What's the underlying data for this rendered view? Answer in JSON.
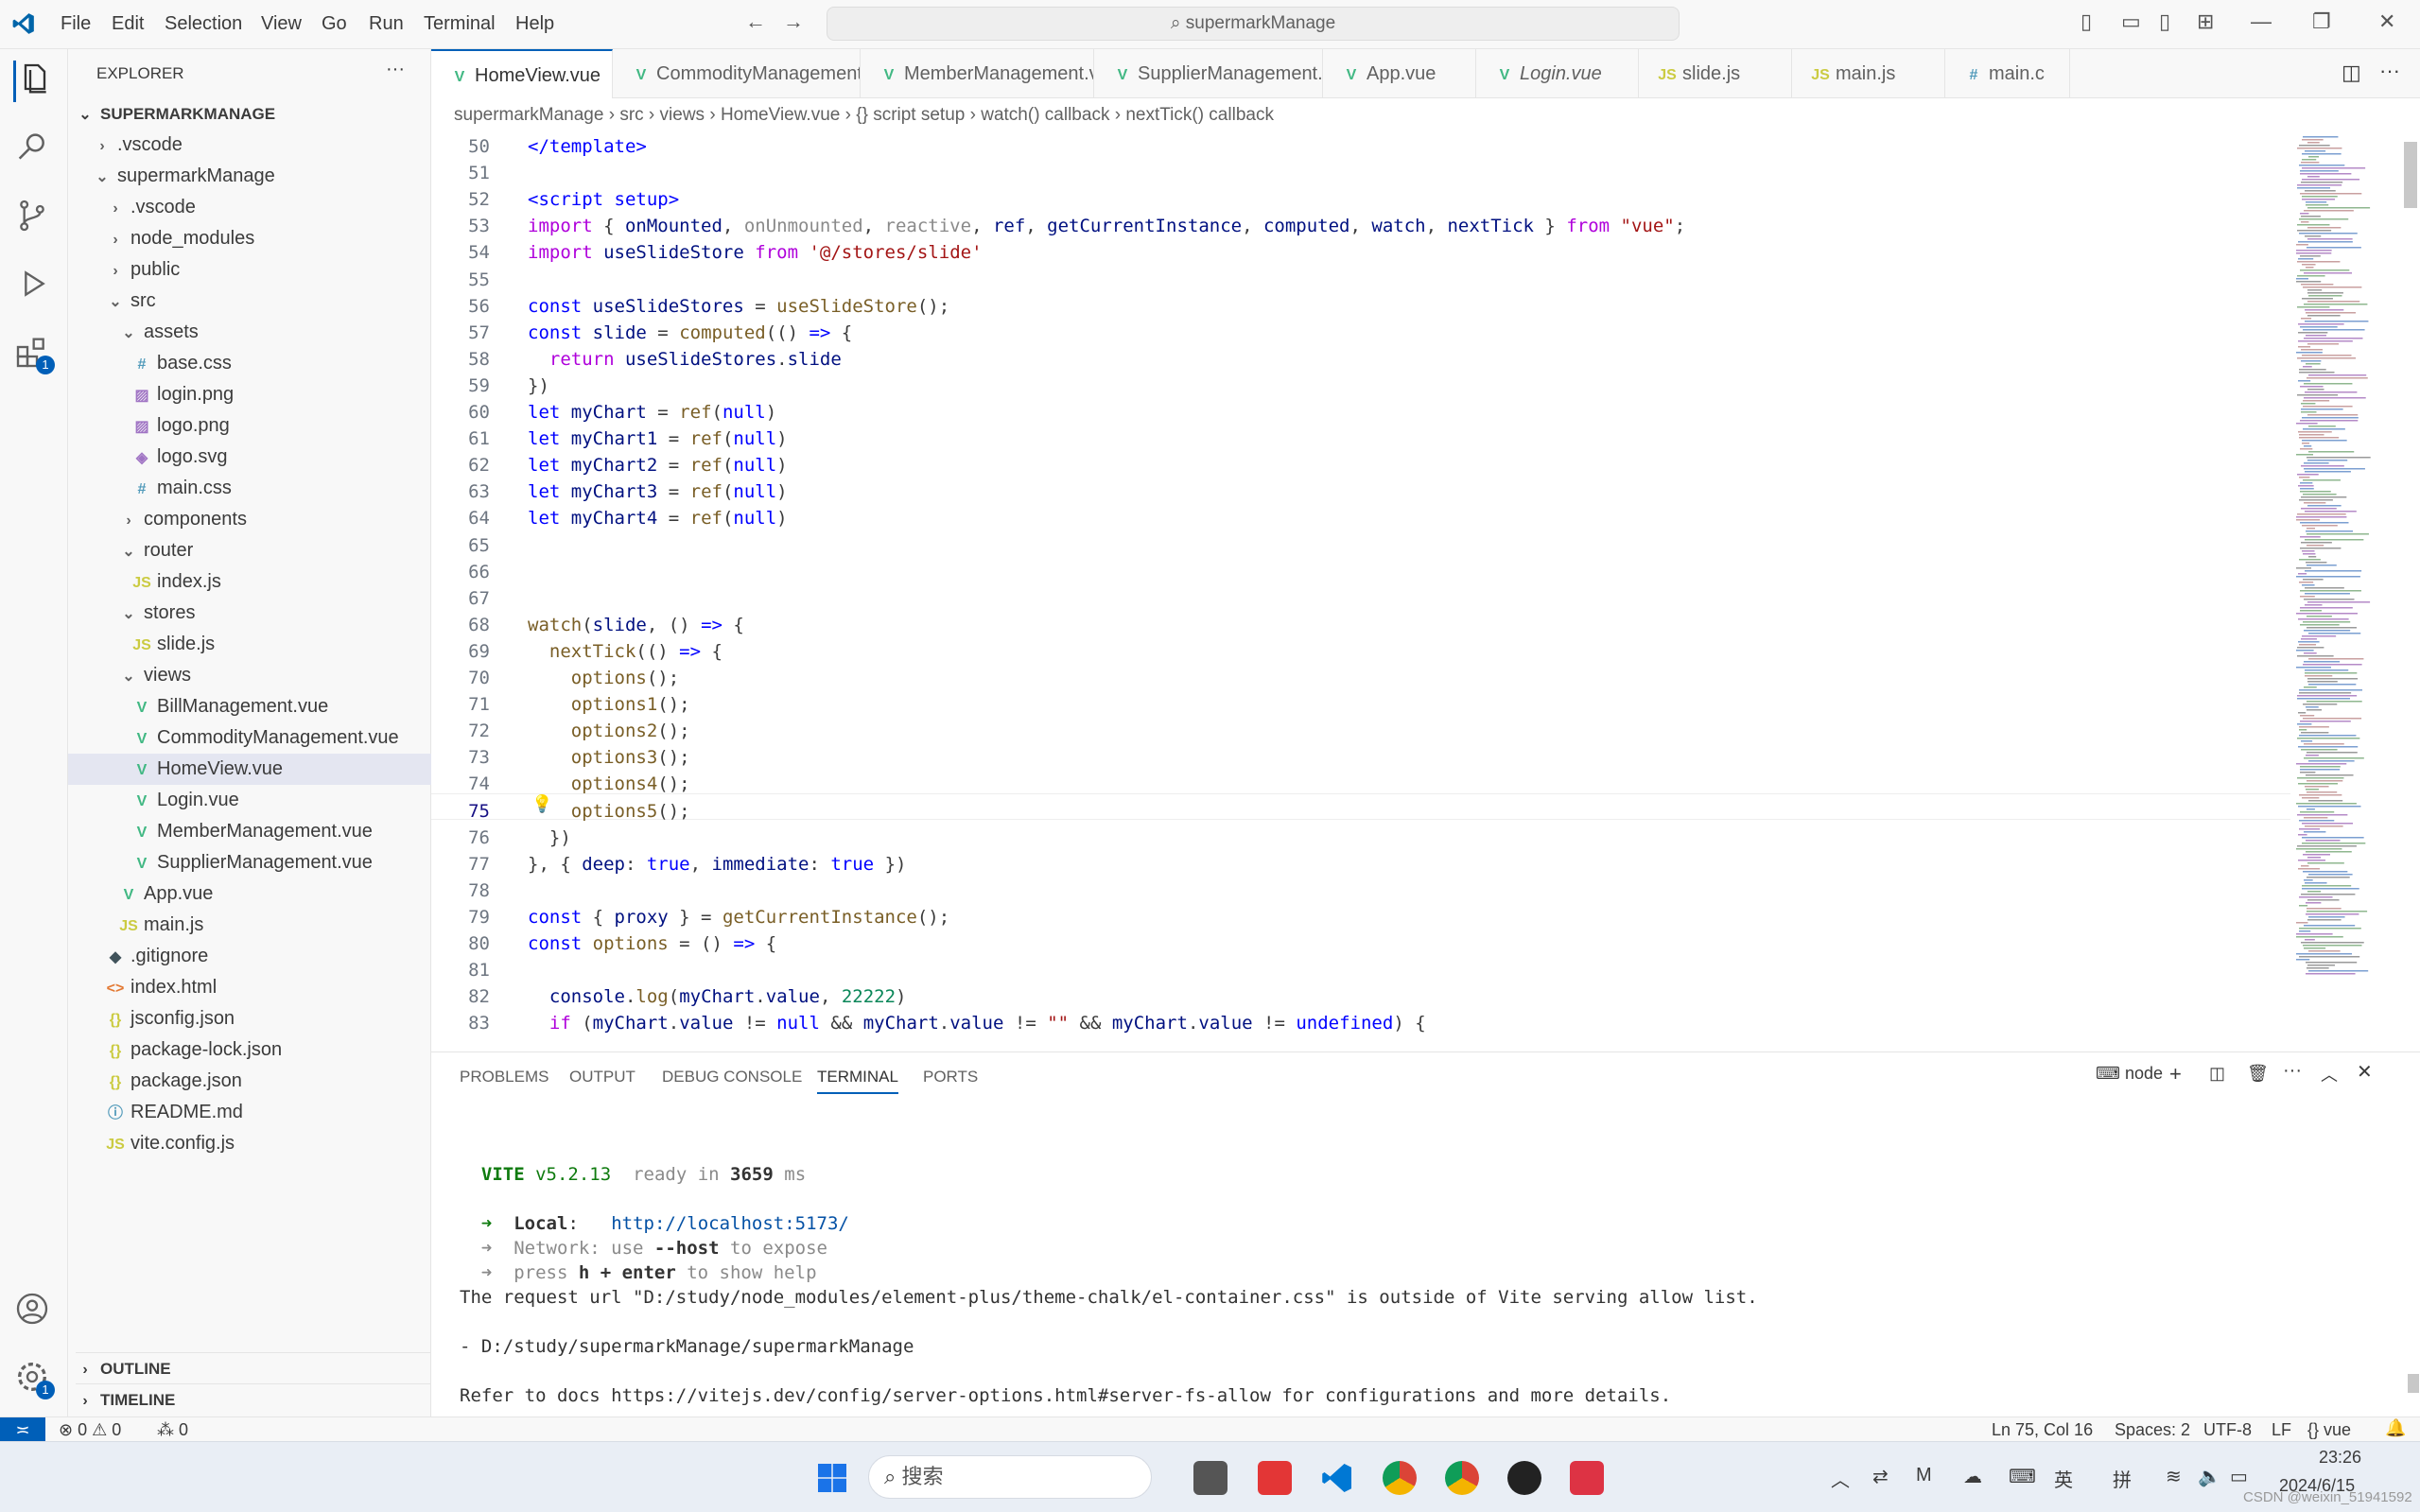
{
  "titlebar": {
    "menus": [
      "File",
      "Edit",
      "Selection",
      "View",
      "Go",
      "Run",
      "Terminal",
      "Help"
    ],
    "search": "supermarkManage"
  },
  "sidebar": {
    "title": "EXPLORER",
    "root": "SUPERMARKMANAGE",
    "items": [
      {
        "label": ".vscode",
        "icon": "chevron-right",
        "depth": 0
      },
      {
        "label": "supermarkManage",
        "icon": "chevron-down",
        "depth": 0
      },
      {
        "label": ".vscode",
        "icon": "chevron-right",
        "depth": 1
      },
      {
        "label": "node_modules",
        "icon": "chevron-right",
        "depth": 1
      },
      {
        "label": "public",
        "icon": "chevron-right",
        "depth": 1
      },
      {
        "label": "src",
        "icon": "chevron-down",
        "depth": 1
      },
      {
        "label": "assets",
        "icon": "chevron-down",
        "depth": 2
      },
      {
        "label": "base.css",
        "icon": "css",
        "depth": 3
      },
      {
        "label": "login.png",
        "icon": "image",
        "depth": 3
      },
      {
        "label": "logo.png",
        "icon": "image",
        "depth": 3
      },
      {
        "label": "logo.svg",
        "icon": "svg",
        "depth": 3
      },
      {
        "label": "main.css",
        "icon": "css",
        "depth": 3
      },
      {
        "label": "components",
        "icon": "chevron-right",
        "depth": 2
      },
      {
        "label": "router",
        "icon": "chevron-down",
        "depth": 2
      },
      {
        "label": "index.js",
        "icon": "js",
        "depth": 3
      },
      {
        "label": "stores",
        "icon": "chevron-down",
        "depth": 2
      },
      {
        "label": "slide.js",
        "icon": "js",
        "depth": 3
      },
      {
        "label": "views",
        "icon": "chevron-down",
        "depth": 2
      },
      {
        "label": "BillManagement.vue",
        "icon": "vue",
        "depth": 3
      },
      {
        "label": "CommodityManagement.vue",
        "icon": "vue",
        "depth": 3
      },
      {
        "label": "HomeView.vue",
        "icon": "vue",
        "depth": 3,
        "selected": true
      },
      {
        "label": "Login.vue",
        "icon": "vue",
        "depth": 3
      },
      {
        "label": "MemberManagement.vue",
        "icon": "vue",
        "depth": 3
      },
      {
        "label": "SupplierManagement.vue",
        "icon": "vue",
        "depth": 3
      },
      {
        "label": "App.vue",
        "icon": "vue",
        "depth": 2
      },
      {
        "label": "main.js",
        "icon": "js",
        "depth": 2
      },
      {
        "label": ".gitignore",
        "icon": "git",
        "depth": 1
      },
      {
        "label": "index.html",
        "icon": "html",
        "depth": 1
      },
      {
        "label": "jsconfig.json",
        "icon": "json",
        "depth": 1
      },
      {
        "label": "package-lock.json",
        "icon": "json",
        "depth": 1
      },
      {
        "label": "package.json",
        "icon": "json",
        "depth": 1
      },
      {
        "label": "README.md",
        "icon": "info",
        "depth": 1
      },
      {
        "label": "vite.config.js",
        "icon": "js",
        "depth": 1
      }
    ],
    "outline": "OUTLINE",
    "timeline": "TIMELINE"
  },
  "tabs": [
    {
      "label": "HomeView.vue",
      "icon": "vue",
      "active": true
    },
    {
      "label": "CommodityManagement.vue",
      "icon": "vue"
    },
    {
      "label": "MemberManagement.vue",
      "icon": "vue"
    },
    {
      "label": "SupplierManagement.vue",
      "icon": "vue"
    },
    {
      "label": "App.vue",
      "icon": "vue"
    },
    {
      "label": "Login.vue",
      "icon": "vue",
      "italic": true
    },
    {
      "label": "slide.js",
      "icon": "js"
    },
    {
      "label": "main.js",
      "icon": "js"
    },
    {
      "label": "main.c",
      "icon": "css"
    }
  ],
  "breadcrumb": [
    "supermarkManage",
    "src",
    "views",
    "HomeView.vue",
    "{} script setup",
    "watch() callback",
    "nextTick() callback"
  ],
  "editor": {
    "lines": [
      {
        "n": "50",
        "html": "<span class='kw'>&lt;/template&gt;</span>"
      },
      {
        "n": "51",
        "html": ""
      },
      {
        "n": "52",
        "html": "<span class='kw'>&lt;script setup&gt;</span>"
      },
      {
        "n": "53",
        "html": "<span class='c2'>import</span> { <span class='var'>onMounted</span>, <span class='dim'>onUnmounted</span>, <span class='dim'>reactive</span>, <span class='var'>ref</span>, <span class='var'>getCurrentInstance</span>, <span class='var'>computed</span>, <span class='var'>watch</span>, <span class='var'>nextTick</span> } <span class='c2'>from</span> <span class='str'>\"vue\"</span>;"
      },
      {
        "n": "54",
        "html": "<span class='c2'>import</span> <span class='var'>useSlideStore</span> <span class='c2'>from</span> <span class='str'>'@/stores/slide'</span>"
      },
      {
        "n": "55",
        "html": ""
      },
      {
        "n": "56",
        "html": "<span class='kw'>const</span> <span class='var'>useSlideStores</span> = <span class='fn'>useSlideStore</span>();"
      },
      {
        "n": "57",
        "html": "<span class='kw'>const</span> <span class='var'>slide</span> = <span class='fn'>computed</span>(() <span class='kw'>=&gt;</span> {"
      },
      {
        "n": "58",
        "html": "  <span class='c2'>return</span> <span class='var'>useSlideStores</span>.<span class='var'>slide</span>"
      },
      {
        "n": "59",
        "html": "})"
      },
      {
        "n": "60",
        "html": "<span class='kw'>let</span> <span class='var'>myChart</span> = <span class='fn'>ref</span>(<span class='kw'>null</span>)"
      },
      {
        "n": "61",
        "html": "<span class='kw'>let</span> <span class='var'>myChart1</span> = <span class='fn'>ref</span>(<span class='kw'>null</span>)"
      },
      {
        "n": "62",
        "html": "<span class='kw'>let</span> <span class='var'>myChart2</span> = <span class='fn'>ref</span>(<span class='kw'>null</span>)"
      },
      {
        "n": "63",
        "html": "<span class='kw'>let</span> <span class='var'>myChart3</span> = <span class='fn'>ref</span>(<span class='kw'>null</span>)"
      },
      {
        "n": "64",
        "html": "<span class='kw'>let</span> <span class='var'>myChart4</span> = <span class='fn'>ref</span>(<span class='kw'>null</span>)"
      },
      {
        "n": "65",
        "html": ""
      },
      {
        "n": "66",
        "html": ""
      },
      {
        "n": "67",
        "html": ""
      },
      {
        "n": "68",
        "html": "<span class='fn'>watch</span>(<span class='var'>slide</span>, () <span class='kw'>=&gt;</span> {"
      },
      {
        "n": "69",
        "html": "  <span class='fn'>nextTick</span>(() <span class='kw'>=&gt;</span> {"
      },
      {
        "n": "70",
        "html": "    <span class='fn'>options</span>();"
      },
      {
        "n": "71",
        "html": "    <span class='fn'>options1</span>();"
      },
      {
        "n": "72",
        "html": "    <span class='fn'>options2</span>();"
      },
      {
        "n": "73",
        "html": "    <span class='fn'>options3</span>();"
      },
      {
        "n": "74",
        "html": "    <span class='fn'>options4</span>();"
      },
      {
        "n": "75",
        "html": "    <span class='fn'>options5</span>();"
      },
      {
        "n": "76",
        "html": "  })"
      },
      {
        "n": "77",
        "html": "}, { <span class='var'>deep</span>: <span class='kw'>true</span>, <span class='var'>immediate</span>: <span class='kw'>true</span> })"
      },
      {
        "n": "78",
        "html": ""
      },
      {
        "n": "79",
        "html": "<span class='kw'>const</span> { <span class='var'>proxy</span> } = <span class='fn'>getCurrentInstance</span>();"
      },
      {
        "n": "80",
        "html": "<span class='kw'>const</span> <span class='fn'>options</span> = () <span class='kw'>=&gt;</span> {"
      },
      {
        "n": "81",
        "html": ""
      },
      {
        "n": "82",
        "html": "  <span class='var'>console</span>.<span class='fn'>log</span>(<span class='var'>myChart</span>.<span class='var'>value</span>, <span class='num'>22222</span>)"
      },
      {
        "n": "83",
        "html": "  <span class='c2'>if</span> (<span class='var'>myChart</span>.<span class='var'>value</span> != <span class='kw'>null</span> &amp;&amp; <span class='var'>myChart</span>.<span class='var'>value</span> != <span class='str'>\"\"</span> &amp;&amp; <span class='var'>myChart</span>.<span class='var'>value</span> != <span class='kw'>undefined</span>) {"
      }
    ],
    "current_line": "75"
  },
  "panel": {
    "tabs": [
      "PROBLEMS",
      "OUTPUT",
      "DEBUG CONSOLE",
      "TERMINAL",
      "PORTS"
    ],
    "active_tab": "TERMINAL",
    "shell": "node",
    "terminal": [
      {
        "html": "  <b style='color:#0f7b0f'>VITE</b> <span style='color:#0f7b0f'>v5.2.13</span>  <span class='dim'>ready in</span> <b>3659</b> <span class='dim'>ms</span>"
      },
      {
        "html": ""
      },
      {
        "html": "  <span style='color:#0f7b0f'>➜</span>  <b>Local</b>:   <span style='color:#0451a5'>http://localhost:5173/</span>"
      },
      {
        "html": "  <span class='dim'>➜  Network: use </span><b>--host</b><span class='dim'> to expose</span>"
      },
      {
        "html": "  <span class='dim'>➜  press </span><b>h + enter</b><span class='dim'> to show help</span>"
      },
      {
        "html": "The request url \"D:/study/node_modules/element-plus/theme-chalk/el-container.css\" is outside of Vite serving allow list."
      },
      {
        "html": ""
      },
      {
        "html": "- D:/study/supermarkManage/supermarkManage"
      },
      {
        "html": ""
      },
      {
        "html": "Refer to docs https://vitejs.dev/config/server-options.html#server-fs-allow for configurations and more details."
      }
    ]
  },
  "statusbar": {
    "errors": "0",
    "warnings": "0",
    "ports": "0",
    "position": "Ln 75, Col 16",
    "spaces": "Spaces: 2",
    "encoding": "UTF-8",
    "eol": "LF",
    "language": "vue"
  },
  "taskbar": {
    "search": "搜索",
    "lang1": "英",
    "lang2": "拼",
    "time": "23:26",
    "date": "2024/6/15",
    "watermark": "CSDN @weixin_51941592"
  },
  "colors": {
    "accent": "#005fb8",
    "vue": "#41b883",
    "js": "#cbcb41",
    "css": "#519aba"
  }
}
